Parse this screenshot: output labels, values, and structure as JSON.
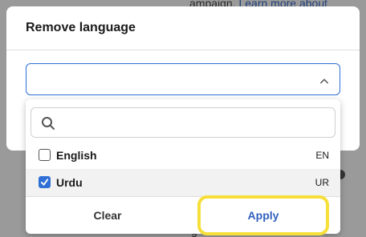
{
  "background": {
    "text_prefix": "ampaign.",
    "link_text": "Learn more about",
    "bottom_fragment": "g"
  },
  "modal": {
    "title": "Remove language",
    "select": {
      "value": ""
    }
  },
  "dropdown": {
    "search": {
      "value": "",
      "icon": "search-icon"
    },
    "options": [
      {
        "label": "English",
        "code": "EN",
        "checked": false
      },
      {
        "label": "Urdu",
        "code": "UR",
        "checked": true
      }
    ],
    "clear_label": "Clear",
    "apply_label": "Apply"
  },
  "colors": {
    "accent": "#2f6fd6",
    "highlight": "#f7df3a"
  }
}
